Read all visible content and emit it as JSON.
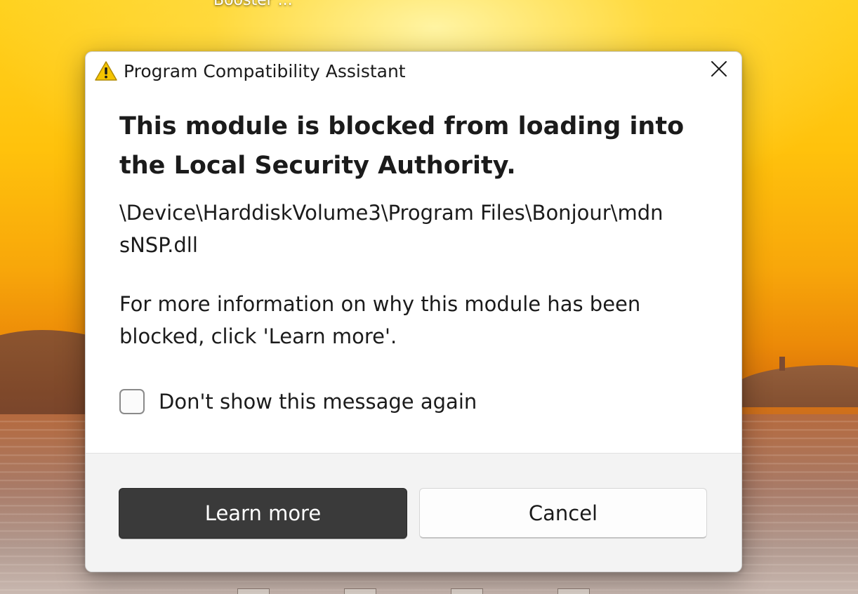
{
  "desktop": {
    "icon_label": "Booster ..."
  },
  "dialog": {
    "title": "Program Compatibility Assistant",
    "title_icon": "warning-icon",
    "close_icon": "close-icon",
    "heading": "This module is blocked from loading into the Local Security Authority.",
    "module_path": "\\Device\\HarddiskVolume3\\Program Files\\Bonjour\\mdnsNSP.dll",
    "info": "For more information on why this module has been blocked, click 'Learn more'.",
    "checkbox": {
      "label": "Don't show this message again",
      "checked": false
    },
    "buttons": {
      "learn_more": "Learn more",
      "cancel": "Cancel"
    }
  },
  "colors": {
    "primary_button": "#3a3a3a",
    "warning_yellow": "#f5c400",
    "footer_bg": "#f3f3f3"
  }
}
